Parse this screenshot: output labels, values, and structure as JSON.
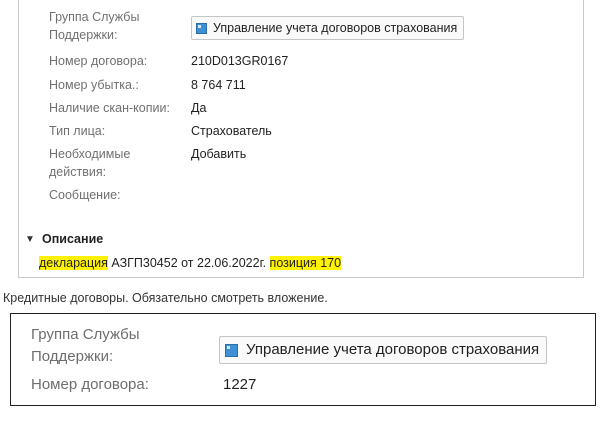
{
  "panel1": {
    "fields": [
      {
        "label": "Группа Службы Поддержки:",
        "value": "Управление учета договоров страхования",
        "icon": "ticket-icon"
      },
      {
        "label": "Номер договора:",
        "value": "210D013GR0167"
      },
      {
        "label": "Номер убытка.:",
        "value": "8 764 711"
      },
      {
        "label": "Наличие скан-копии:",
        "value": "Да"
      },
      {
        "label": "Тип лица:",
        "value": "Страхователь"
      },
      {
        "label": "Необходимые действия:",
        "value": "Добавить"
      },
      {
        "label": "Сообщение:",
        "value": ""
      }
    ],
    "description": {
      "title": "Описание",
      "parts": [
        {
          "text": "декларация",
          "highlight": true
        },
        {
          "text": " АЗГП30452 от 22.06.2022г. ",
          "highlight": false
        },
        {
          "text": "позиция 170",
          "highlight": true
        }
      ]
    }
  },
  "note": "Кредитные договоры. Обязательно смотреть вложение.",
  "panel2": {
    "fields": [
      {
        "label": "Группа Службы Поддержки:",
        "value": "Управление учета договоров страхования"
      },
      {
        "label": "Номер договора:",
        "value": "1227"
      }
    ]
  },
  "colors": {
    "highlight": "#fff200",
    "icon": "#3d8fd6"
  }
}
